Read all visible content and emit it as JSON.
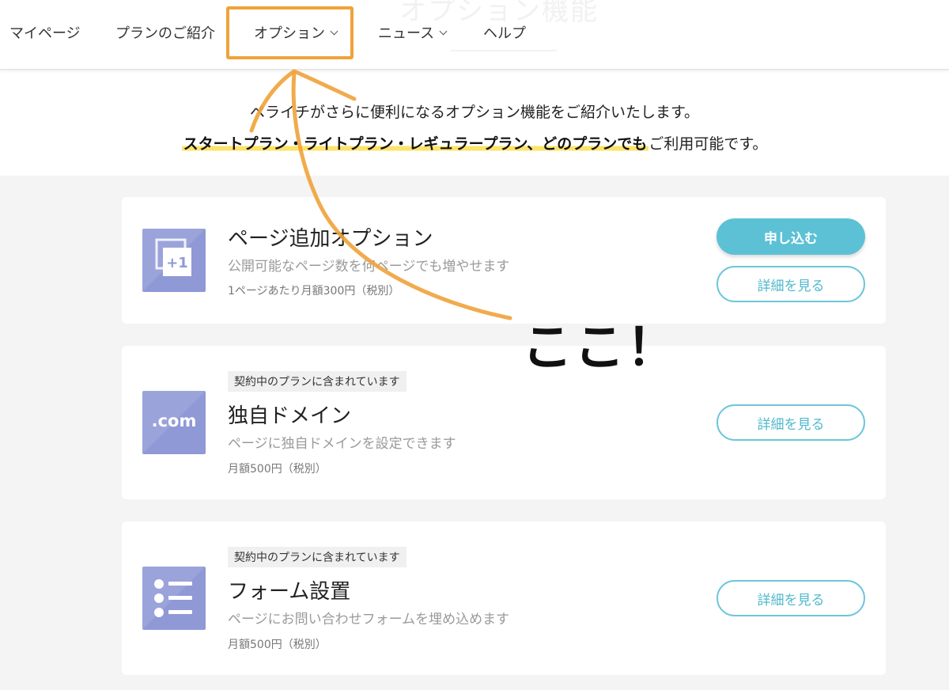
{
  "header": {
    "ghost_title": "オプション機能",
    "nav": [
      {
        "label": "マイページ"
      },
      {
        "label": "プランのご紹介"
      },
      {
        "label": "オプション"
      },
      {
        "label": "ニュース"
      },
      {
        "label": "ヘルプ"
      }
    ]
  },
  "intro": {
    "line1": "ペライチがさらに便利になるオプション機能をご紹介いたします。",
    "highlight": "スタートプラン・ライトプラン・レギュラープラン、どのプランでも",
    "suffix": "ご利用可能です。"
  },
  "options": [
    {
      "icon": "page-plus-one-icon",
      "icon_text": "+1",
      "title": "ページ追加オプション",
      "desc": "公開可能なページ数を何ページでも増やせます",
      "price": "1ページあたり月額300円（税別）",
      "apply_label": "申し込む",
      "detail_label": "詳細を見る"
    },
    {
      "icon": "domain-icon",
      "icon_text": ".com",
      "badge": "契約中のプランに含まれています",
      "title": "独自ドメイン",
      "desc": "ページに独自ドメインを設定できます",
      "price": "月額500円（税別）",
      "detail_label": "詳細を見る"
    },
    {
      "icon": "form-list-icon",
      "badge": "契約中のプランに含まれています",
      "title": "フォーム設置",
      "desc": "ページにお問い合わせフォームを埋め込めます",
      "price": "月額500円（税別）",
      "detail_label": "詳細を見る"
    }
  ],
  "annotation": {
    "text": "ここ！",
    "color": "#f0a23a"
  }
}
